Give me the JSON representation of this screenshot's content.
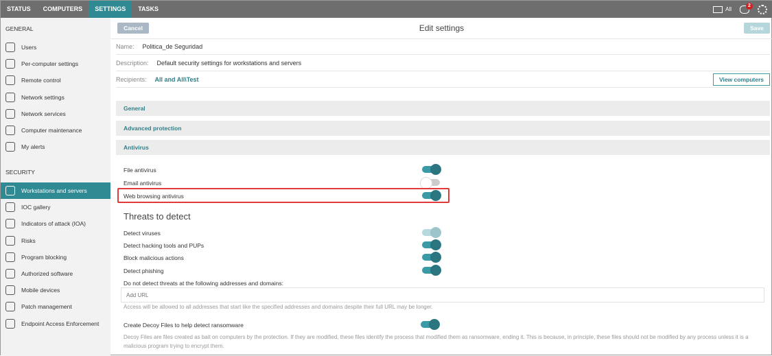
{
  "top": {
    "tabs": [
      "STATUS",
      "COMPUTERS",
      "SETTINGS",
      "TASKS"
    ],
    "active": "SETTINGS",
    "folder_label": "All",
    "notif_count": "2"
  },
  "sidebar": {
    "general_header": "GENERAL",
    "general": [
      "Users",
      "Per-computer settings",
      "Remote control",
      "Network settings",
      "Network services",
      "Computer maintenance",
      "My alerts"
    ],
    "security_header": "SECURITY",
    "security": [
      "Workstations and servers",
      "IOC gallery",
      "Indicators of attack (IOA)",
      "Risks",
      "Program blocking",
      "Authorized software",
      "Mobile devices",
      "Patch management",
      "Endpoint Access Enforcement"
    ]
  },
  "header": {
    "cancel": "Cancel",
    "title": "Edit settings",
    "save": "Save"
  },
  "form": {
    "name_label": "Name:",
    "name": "Politica_de Seguridad",
    "desc_label": "Description:",
    "desc": "Default security settings for workstations and servers",
    "recip_label": "Recipients:",
    "recip": "All and All\\Test",
    "view": "View computers"
  },
  "sections": [
    "General",
    "Advanced protection",
    "Antivirus"
  ],
  "antivirus": [
    {
      "label": "File antivirus",
      "on": true
    },
    {
      "label": "Email antivirus",
      "on": false
    },
    {
      "label": "Web browsing antivirus",
      "on": true
    }
  ],
  "threats": {
    "title": "Threats to detect",
    "items": [
      {
        "label": "Detect viruses",
        "on": true
      },
      {
        "label": "Detect hacking tools and PUPs",
        "on": true
      },
      {
        "label": "Block malicious actions",
        "on": true
      },
      {
        "label": "Detect phishing",
        "on": true
      }
    ],
    "exclude_label": "Do not detect threats at the following addresses and domains:",
    "url_placeholder": "Add URL",
    "exclude_help": "Access will be allowed to all addresses that start like the specified addresses and domains despite their full URL may be longer.",
    "decoy_label": "Create Decoy Files to help detect ransomware",
    "decoy_on": true,
    "decoy_help": "Decoy Files are files created as bait on computers by the protection. If they are modified, these files identify the process that modified them as ransomware, ending it. This is because, in principle, these files should not be modified by any process unless it is a malicious program trying to encrypt them."
  }
}
